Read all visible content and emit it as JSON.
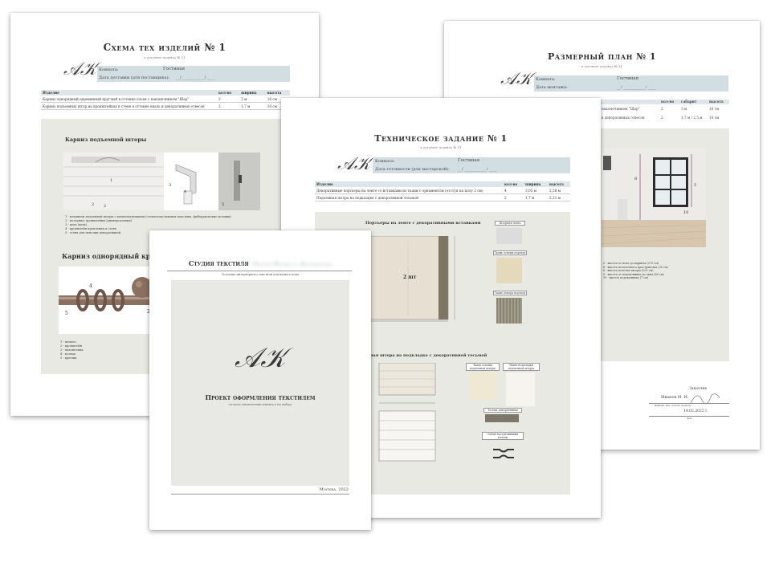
{
  "scheme": {
    "title": "Схема тех изделий № 1",
    "subtitle": "к договору подряда № 21",
    "room_label": "Комната:",
    "room_value": "Гостиная",
    "date_label": "Дата доставки (для поставщика):",
    "date_blank": "__/ ___________/ ____",
    "columns": [
      "Изделие",
      "кол-во",
      "ширина",
      "высота"
    ],
    "rows": [
      [
        "Карниз однорядный деревянный круглый в оттенке ольхи с наконечником \"Шар\"",
        "2",
        "3 м",
        "16 см"
      ],
      [
        "Карниз подъемных штор на кронштейнах в стене в оттенке кваль и декоративных отвесок",
        "2",
        "1,7 м",
        "10 см"
      ]
    ],
    "panel1_title": "Карниз подъемной шторы",
    "panel1_legend": [
      "1 - механизм подъемной шторы с комплектующими (стеклопластиковая пластина, фибердисковые вставки)",
      "2 - ползунки, кронштейны (универсальные)",
      "3 - цепь (цепь)",
      "4 - кронштейн крепления к стене",
      "5 - стена для цепочки декоративной"
    ],
    "panel2_title": "Карниз однорядный круглый",
    "panel2_legend": [
      "1 - штанга",
      "2 - кронштейн",
      "3 - наконечник",
      "4 - кольца",
      "5 - крючки"
    ]
  },
  "size_plan": {
    "title": "Размерный план № 1",
    "subtitle": "к договору подряда № 21",
    "room_label": "Комната:",
    "room_value": "Гостиная",
    "date_label": "Дата монтажа:",
    "date_blank": "__/ ___________/ ____",
    "columns": [
      "кол-во",
      "габарит",
      "высота"
    ],
    "rows": [
      [
        "наконечником \"Шар\"",
        "2",
        "3 м",
        "16 см"
      ],
      [
        "в декоративных отвесок",
        "2",
        "1,7 м / 2,5 м",
        "10 см"
      ]
    ],
    "legend": [
      "5 - высота от пола до карниза (270 см)",
      "6 - высота потолочного пространства (30 см)",
      "8 - высота полотна шторы (200 см)",
      "9 - высота от подоконника до окна (40 см)",
      "10 - высота подоконника (7 см)"
    ],
    "client_label": "Заказчик",
    "client_name": "Иванов И. И.",
    "client_caption": "Фамилия, имя, отчество (подпись)",
    "date_signed": "14.02.2022 г.",
    "date_caption": "Дата"
  },
  "tech_task": {
    "title": "Техническое задание № 1",
    "subtitle": "к договору подряда № 21",
    "room_label": "Комната:",
    "room_value": "Гостиная",
    "date_label": "Дата готовности (для мастерской):",
    "date_blank": "__/ ___________/ ____",
    "columns": [
      "Изделие",
      "кол-во",
      "ширина",
      "высота"
    ],
    "rows": [
      [
        "Декоративные портьеры на ленте со вставками из ткани с орнаментом (отступ на полу 2 см)",
        "4",
        "3,05 м",
        "2,58 м"
      ],
      [
        "Подъемная штора на подкладке с декоративной тесьмой",
        "2",
        "1,7 м",
        "2,21 м"
      ]
    ],
    "section1_title": "Портьеры на ленте с декоративными вставками",
    "section1_center": "2 шт",
    "tags1": [
      "Шторная лента",
      "Ткань основы портьер",
      "Ткань декора портьер"
    ],
    "section2_title": "Подъемная штора на подкладке с декоративной тесьмой",
    "tags2": [
      "Ткань основы подъемной шторы",
      "Ткань подкладки подъемной шторы",
      "Тесьма декоративная",
      "Схема настрачивания тесьмы"
    ]
  },
  "cover": {
    "studio_label": "Студия текстиля",
    "studio_name": "«Ателье» Москва ул. Дизайнерская",
    "tagline": "Эстетика интерьерного текстиля для вашего дома",
    "logo_text": "AK",
    "project_title": "Проект оформления текстилем",
    "project_sub": "согласно ознакомлению клиента и его выбора",
    "city_year": "Москва, 2022"
  }
}
